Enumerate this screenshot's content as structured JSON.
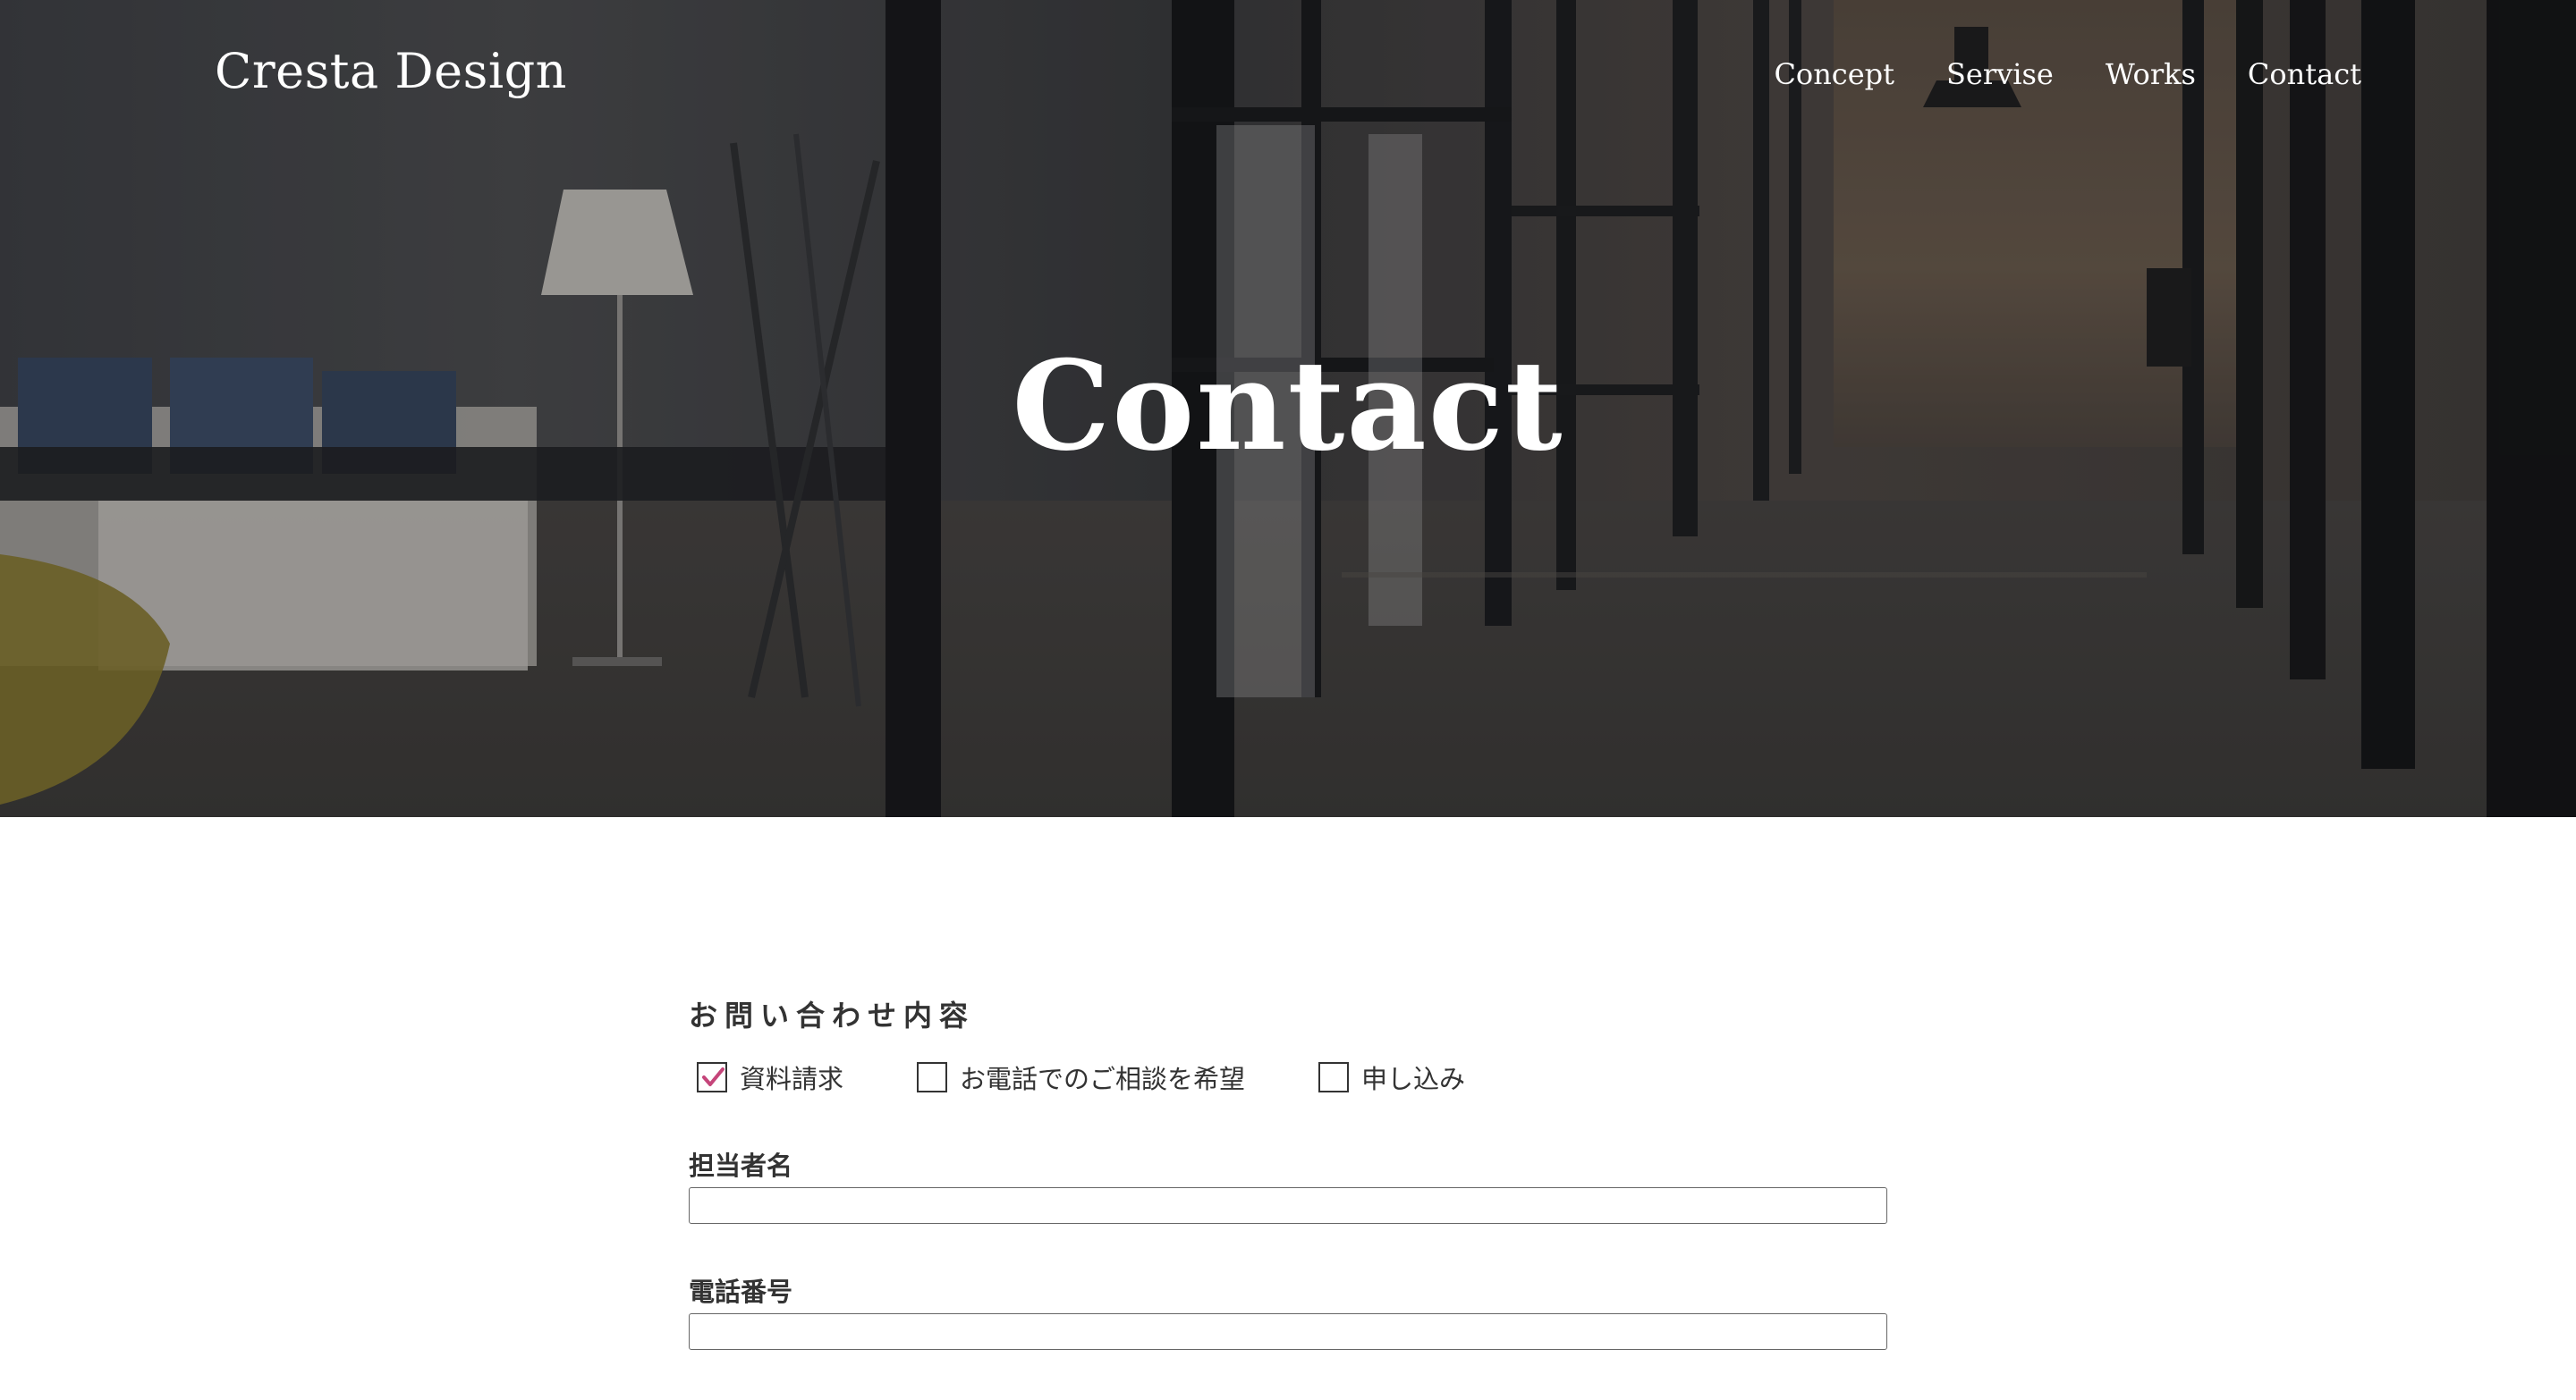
{
  "header": {
    "brand": "Cresta Design",
    "nav": [
      "Concept",
      "Servise",
      "Works",
      "Contact"
    ]
  },
  "hero": {
    "title": "Contact"
  },
  "form": {
    "inquiry_label": "お問い合わせ内容",
    "options": [
      {
        "label": "資料請求",
        "checked": true
      },
      {
        "label": "お電話でのご相談を希望",
        "checked": false
      },
      {
        "label": "申し込み",
        "checked": false
      }
    ],
    "name_label": "担当者名",
    "name_value": "",
    "phone_label": "電話番号",
    "phone_value": ""
  },
  "colors": {
    "check_accent": "#c5457a",
    "text": "#333333",
    "hero_text": "#ffffff"
  }
}
